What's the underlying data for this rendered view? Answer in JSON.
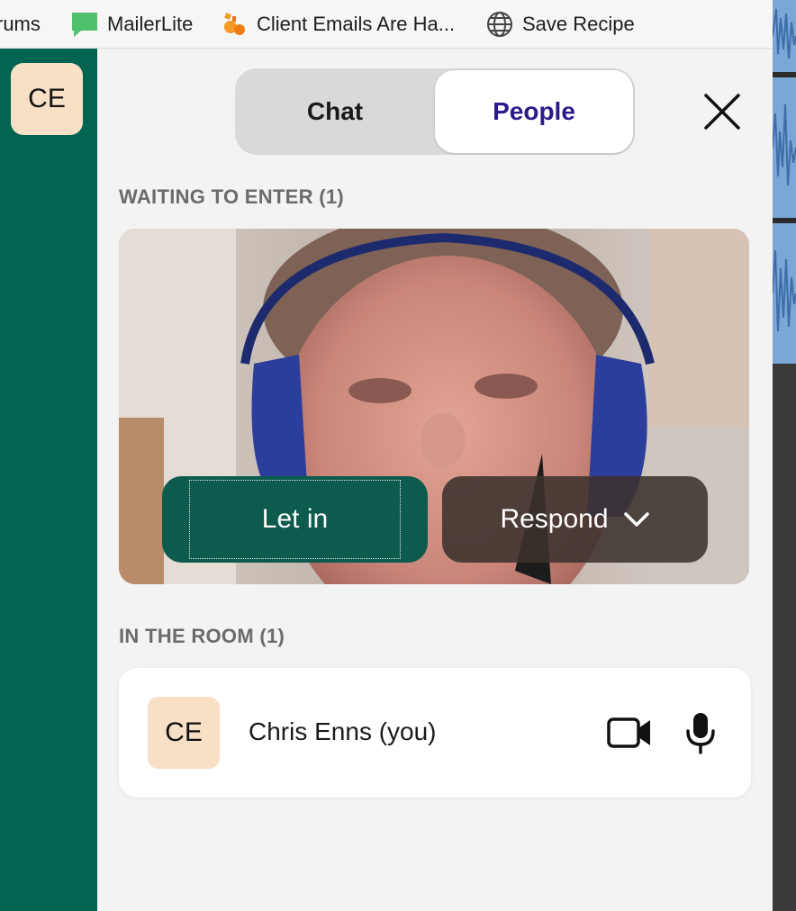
{
  "bookmarks": [
    {
      "label": "rums",
      "icon": "forum-icon"
    },
    {
      "label": "MailerLite",
      "icon": "mailerlite-chat-icon"
    },
    {
      "label": "Client Emails Are Ha...",
      "icon": "bookmark-favicon-icon"
    },
    {
      "label": "Save Recipe",
      "icon": "globe-icon"
    }
  ],
  "rail": {
    "avatar_initials": "CE"
  },
  "tabs": {
    "chat": "Chat",
    "people": "People",
    "active": "People"
  },
  "colors": {
    "rail": "#006450",
    "active_tab_text": "#2a1a8c",
    "let_in_button": "#0c5b4c",
    "avatar_bg": "#f7e0c6"
  },
  "waiting": {
    "heading": "WAITING TO ENTER (1)",
    "let_in_label": "Let in",
    "respond_label": "Respond"
  },
  "room": {
    "heading": "IN THE ROOM (1)",
    "participants": [
      {
        "initials": "CE",
        "name": "Chris Enns (you)"
      }
    ]
  }
}
